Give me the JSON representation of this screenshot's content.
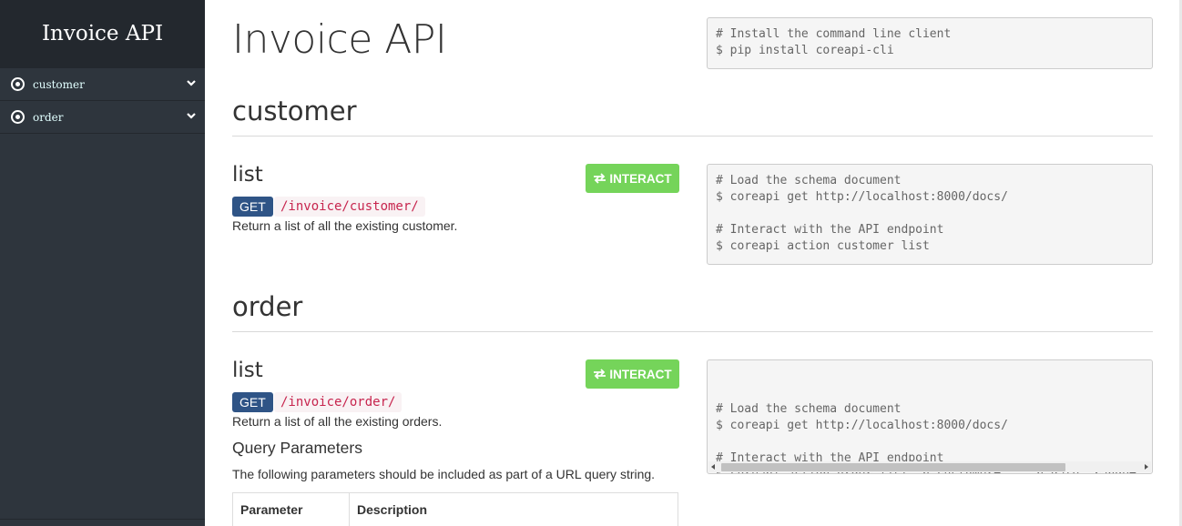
{
  "sidebar": {
    "brand": "Invoice API",
    "items": [
      {
        "label": "customer",
        "icon": "radio-dot-icon",
        "chevron": "chevron-down-icon"
      },
      {
        "label": "order",
        "icon": "radio-dot-icon",
        "chevron": "chevron-down-icon"
      }
    ]
  },
  "main": {
    "title": "Invoice API",
    "install_code": "# Install the command line client\n$ pip install coreapi-cli",
    "sections": [
      {
        "title": "customer",
        "endpoint": {
          "title": "list",
          "method": "GET",
          "path": "/invoice/customer/",
          "description": "Return a list of all the existing customer.",
          "interact_label": "INTERACT",
          "code": "# Load the schema document\n$ coreapi get http://localhost:8000/docs/\n\n# Interact with the API endpoint\n$ coreapi action customer list"
        }
      },
      {
        "title": "order",
        "endpoint": {
          "title": "list",
          "method": "GET",
          "path": "/invoice/order/",
          "description": "Return a list of all the existing orders.",
          "interact_label": "INTERACT",
          "code": "# Load the schema document\n$ coreapi get http://localhost:8000/docs/\n\n# Interact with the API endpoint\n$ coreapi action order list -p customer=... -p date__range=..",
          "query_params_title": "Query Parameters",
          "query_params_desc": "The following parameters should be included as part of a URL query string.",
          "table_headers": [
            "Parameter",
            "Description"
          ]
        }
      }
    ]
  },
  "colors": {
    "sidebar_bg": "#2e353d",
    "brand_bg": "#23282e",
    "get_badge": "#2f5486",
    "interact_button": "#75d45a",
    "path_text": "#c7254e"
  }
}
